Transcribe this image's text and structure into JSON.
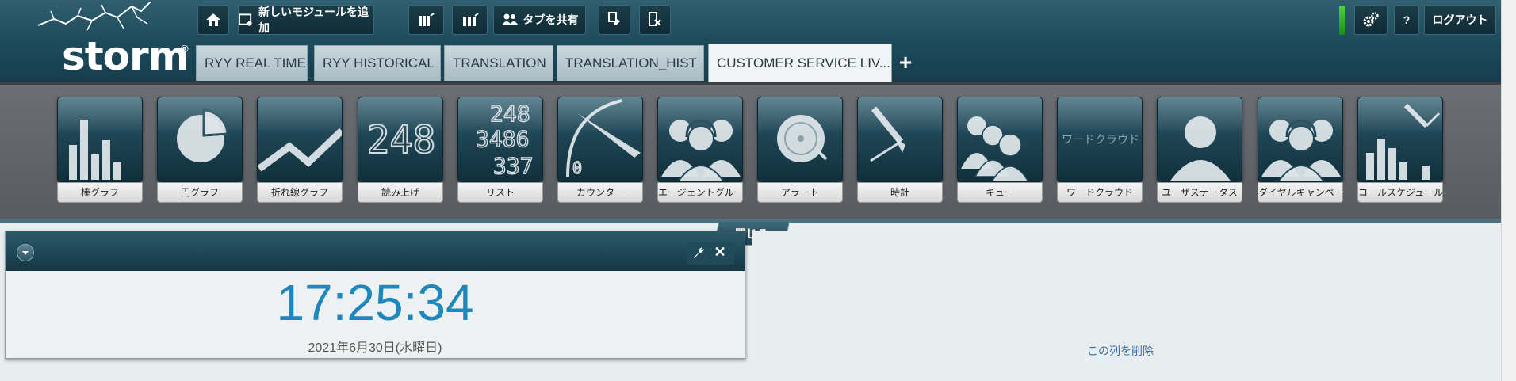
{
  "app": {
    "logo_text": "storm",
    "logo_reg": "®"
  },
  "toolbar": {
    "home": "home-icon",
    "add_module_label": "新しいモジュールを追加",
    "share_tab_label": "タブを共有",
    "logout_label": "ログアウト",
    "help_label": "?"
  },
  "tabs": [
    {
      "label": "RYY REAL TIME"
    },
    {
      "label": "RYY HISTORICAL"
    },
    {
      "label": "TRANSLATION"
    },
    {
      "label": "TRANSLATION_HIST"
    },
    {
      "label": "CUSTOMER SERVICE LIV..."
    }
  ],
  "modules": [
    {
      "label": "棒グラフ",
      "icon": "bar-chart-icon"
    },
    {
      "label": "円グラフ",
      "icon": "pie-chart-icon"
    },
    {
      "label": "折れ線グラフ",
      "icon": "line-chart-icon"
    },
    {
      "label": "読み上げ",
      "icon": "readout-icon",
      "icon_text": "248"
    },
    {
      "label": "リスト",
      "icon": "list-icon",
      "icon_text": [
        "248",
        "3486",
        "337"
      ]
    },
    {
      "label": "カウンター",
      "icon": "counter-icon",
      "icon_text": "0"
    },
    {
      "label": "エージェントグループ",
      "icon": "agent-group-icon"
    },
    {
      "label": "アラート",
      "icon": "alert-bell-icon"
    },
    {
      "label": "時計",
      "icon": "clock-icon"
    },
    {
      "label": "キュー",
      "icon": "queue-icon"
    },
    {
      "label": "ワードクラウド",
      "icon": "word-cloud-icon",
      "icon_text": "ワードクラウド"
    },
    {
      "label": "ユーザステータス",
      "icon": "user-status-icon"
    },
    {
      "label": "ダイヤルキャンペーン",
      "icon": "dial-campaign-icon"
    },
    {
      "label": "コールスケジュール",
      "icon": "call-schedule-icon"
    }
  ],
  "palette_close_label": "閉じる",
  "widget": {
    "time": "17:25:34",
    "date": "2021年6月30日(水曜日)"
  },
  "delete_column_label": "この列を削除",
  "colors": {
    "header": "#1d4a5b",
    "clock_text": "#1e87be",
    "status_led": "#2fb52f"
  }
}
